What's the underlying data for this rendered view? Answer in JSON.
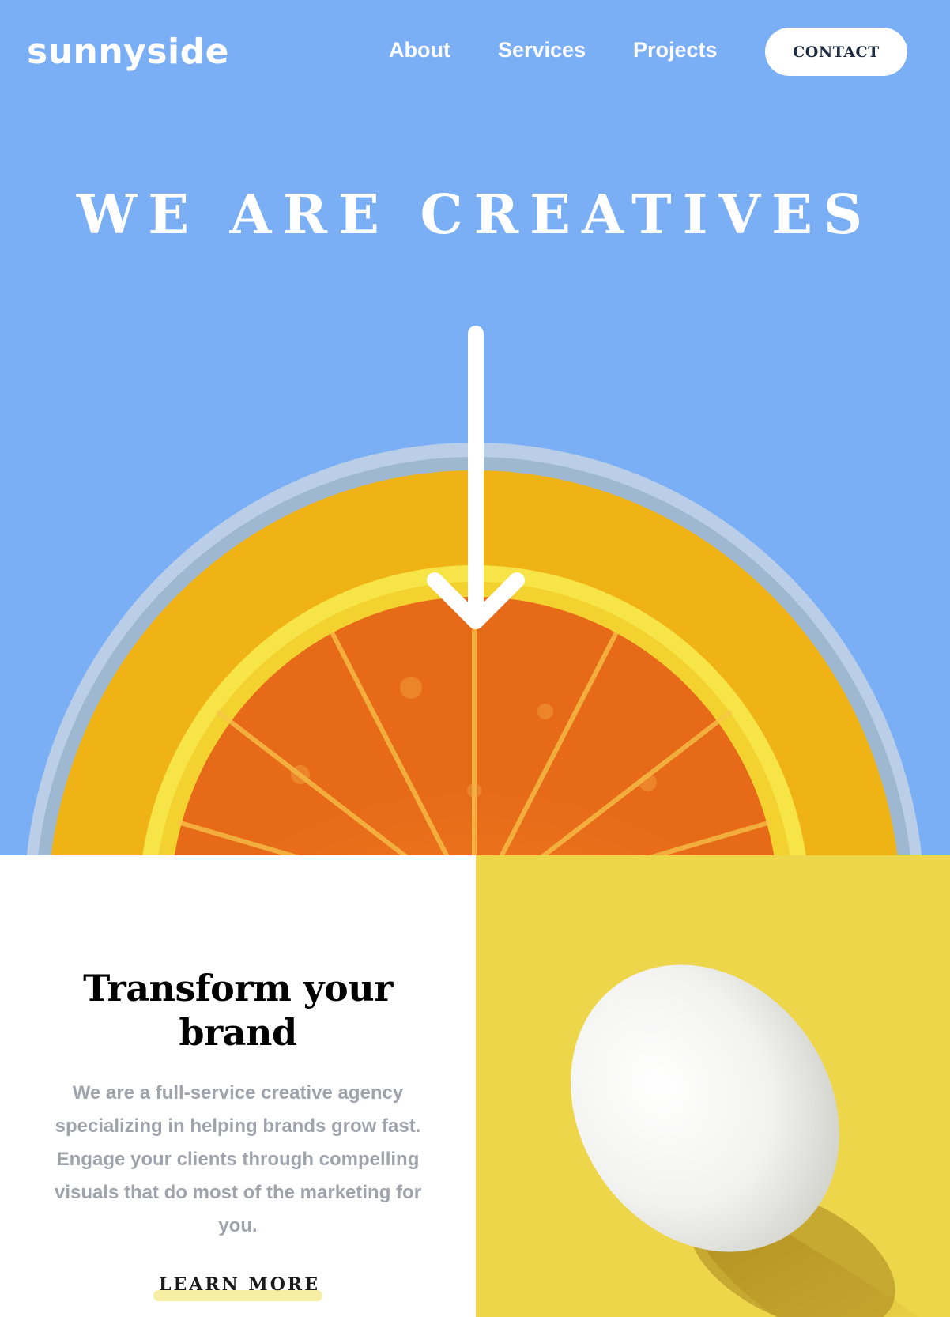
{
  "header": {
    "logo": "sunnyside",
    "nav": {
      "about": "About",
      "services": "Services",
      "projects": "Projects",
      "contact": "CONTACT"
    }
  },
  "hero": {
    "title": "WE ARE CREATIVES",
    "image": "orange-slice-in-glass",
    "arrow_icon": "arrow-down-icon"
  },
  "feature": {
    "heading": "Transform your brand",
    "body": "We are a full-service creative agency specializing in helping brands grow fast. Engage your clients through compelling visuals that do most of the marketing for you.",
    "cta": "LEARN MORE",
    "image": "egg-on-yellow-background"
  },
  "colors": {
    "hero_bg": "#7aaff5",
    "feature_bg": "#ffffff",
    "egg_bg": "#eed64a",
    "heading": "#000000",
    "body_text": "#9fa3ab",
    "cta_underline": "#f6efa3",
    "contact_text": "#1d2b3f"
  }
}
